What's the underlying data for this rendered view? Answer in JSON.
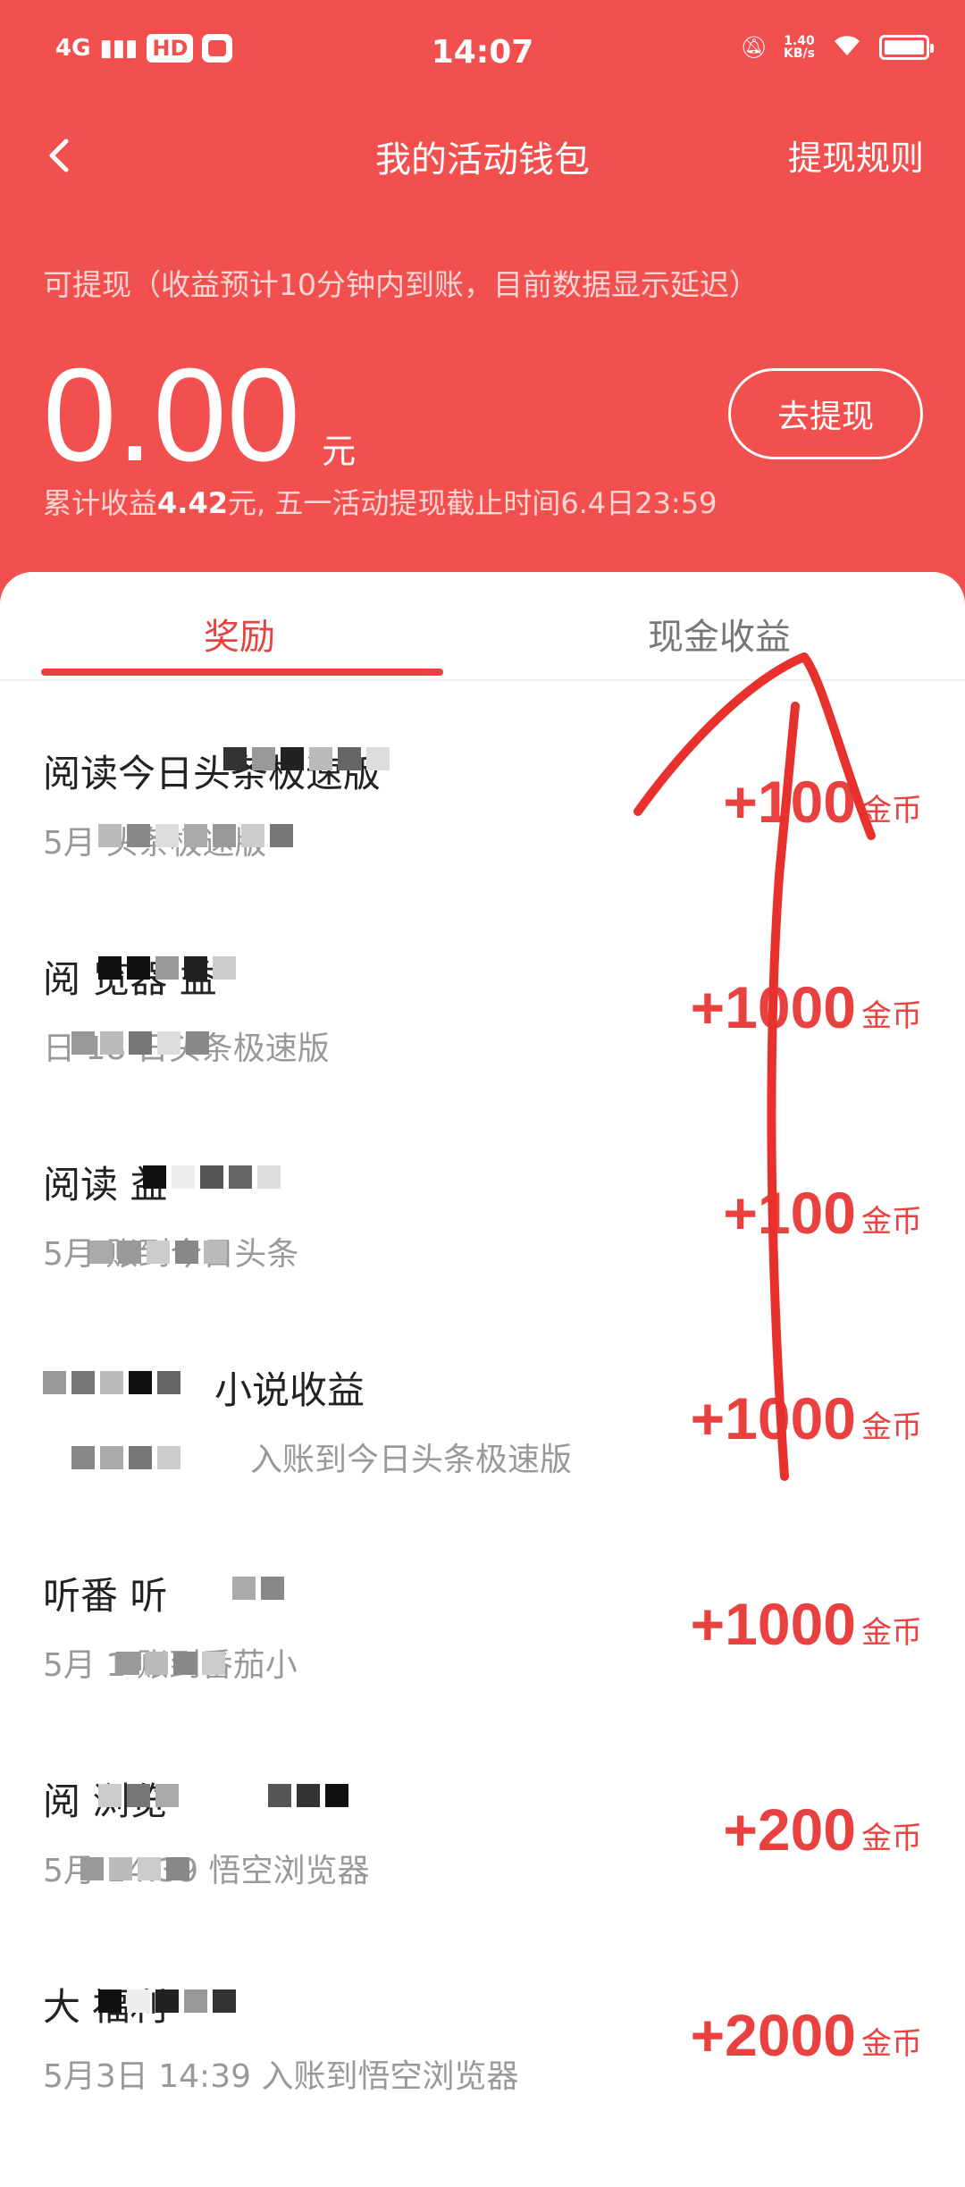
{
  "status_bar": {
    "network": "4G",
    "hd_badge": "HD",
    "time": "14:07",
    "net_speed_value": "1.40",
    "net_speed_unit": "KB/s"
  },
  "nav": {
    "back_icon": "chevron-left-icon",
    "title": "我的活动钱包",
    "rules_link": "提现规则"
  },
  "balance": {
    "note": "可提现（收益预计10分钟内到账，目前数据显示延迟）",
    "amount": "0.00",
    "unit": "元",
    "withdraw_button": "去提现",
    "cumulative_prefix": "累计收益",
    "cumulative_value": "4.42",
    "cumulative_suffix": "元, 五一活动提现截止时间6.4日23:59"
  },
  "tabs": [
    {
      "label": "奖励",
      "active": true
    },
    {
      "label": "现金收益",
      "active": false
    }
  ],
  "rewards": [
    {
      "title": "阅读今日头条极速版",
      "subtitle": "5月 头条极速版",
      "amount": "+100",
      "unit": "金币"
    },
    {
      "title": "阅 览器 益",
      "subtitle": "日 18 日头条极速版",
      "amount": "+1000",
      "unit": "金币"
    },
    {
      "title": "阅读 益",
      "subtitle": "5月 账到今日头条",
      "amount": "+100",
      "unit": "金币"
    },
    {
      "title": "小说收益",
      "subtitle": "入账到今日头条极速版",
      "amount": "+1000",
      "unit": "金币"
    },
    {
      "title": "听番 听",
      "subtitle": "5月 1 账到番茄小",
      "amount": "+1000",
      "unit": "金币"
    },
    {
      "title": "阅 浏览",
      "subtitle": "5月 14:39 悟空浏览器",
      "amount": "+200",
      "unit": "金币"
    },
    {
      "title": "大 福利",
      "subtitle": "5月3日 14:39 入账到悟空浏览器",
      "amount": "+2000",
      "unit": "金币"
    }
  ],
  "colors": {
    "header_bg": "#f2504f",
    "accent": "#e8413f",
    "annotation": "#e8302c"
  }
}
